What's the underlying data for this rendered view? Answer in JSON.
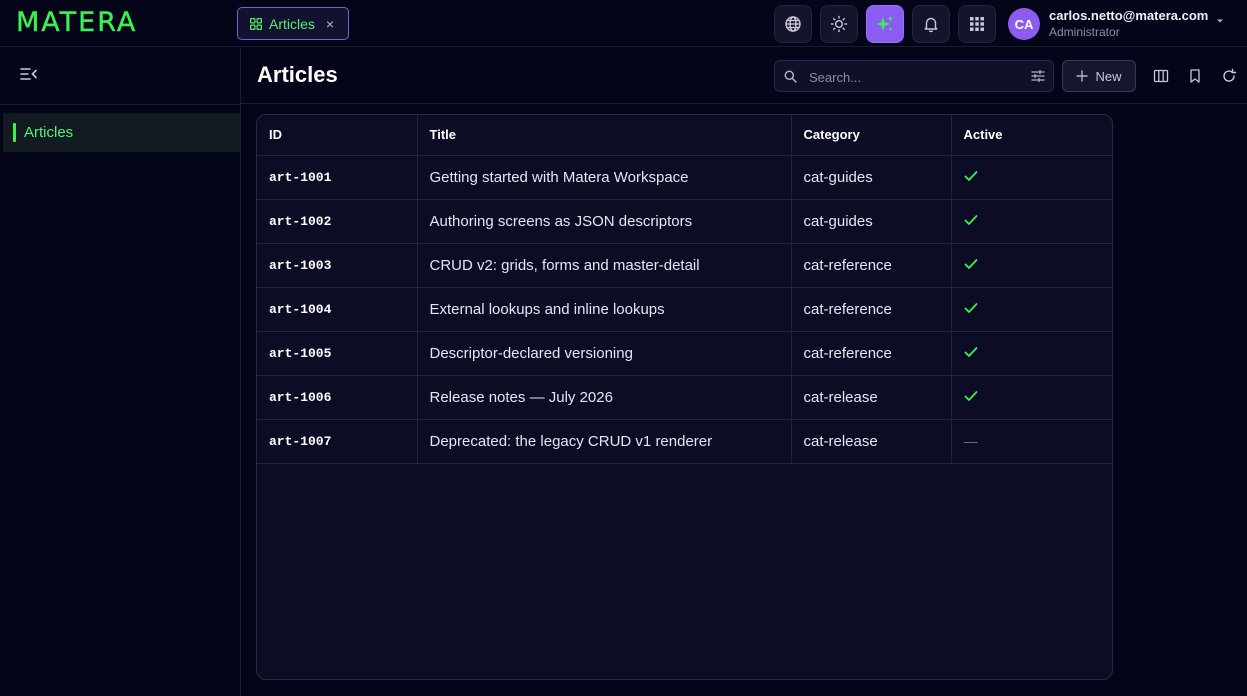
{
  "app": {
    "logo": "MATERA"
  },
  "tab": {
    "label": "Articles",
    "icon": "grid-icon",
    "close": "×"
  },
  "header_icons": [
    "globe-icon",
    "sun-icon",
    "sparkles-icon",
    "bell-icon",
    "apps-grid-icon"
  ],
  "user": {
    "initials": "CA",
    "email": "carlos.netto@matera.com",
    "role": "Administrator"
  },
  "sidebar": {
    "items": [
      {
        "label": "Articles",
        "active": true
      }
    ]
  },
  "page": {
    "title": "Articles",
    "search_placeholder": "Search...",
    "new_label": "New"
  },
  "grid": {
    "columns": [
      "ID",
      "Title",
      "Category",
      "Active"
    ],
    "rows": [
      {
        "id": "art-1001",
        "title": "Getting started with Matera Workspace",
        "category": "cat-guides",
        "active": true
      },
      {
        "id": "art-1002",
        "title": "Authoring screens as JSON descriptors",
        "category": "cat-guides",
        "active": true
      },
      {
        "id": "art-1003",
        "title": "CRUD v2: grids, forms and master-detail",
        "category": "cat-reference",
        "active": true
      },
      {
        "id": "art-1004",
        "title": "External lookups and inline lookups",
        "category": "cat-reference",
        "active": true
      },
      {
        "id": "art-1005",
        "title": "Descriptor-declared versioning",
        "category": "cat-reference",
        "active": true
      },
      {
        "id": "art-1006",
        "title": "Release notes — July 2026",
        "category": "cat-release",
        "active": true
      },
      {
        "id": "art-1007",
        "title": "Deprecated: the legacy CRUD v1 renderer",
        "category": "cat-release",
        "active": false
      }
    ],
    "active_true_glyph": "✓",
    "active_false_glyph": "—"
  },
  "colors": {
    "accent_green": "#39f252",
    "accent_purple": "#8a5cf0",
    "background": "#05051a",
    "panel": "#0c0c24"
  }
}
